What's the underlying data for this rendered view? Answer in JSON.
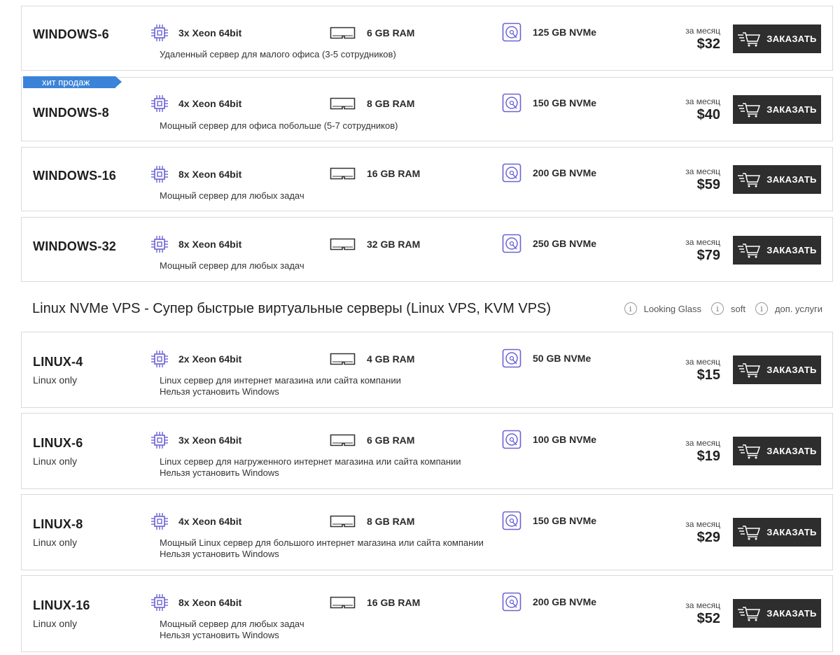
{
  "labels": {
    "per_month": "за месяц",
    "order": "ЗАКАЗАТЬ",
    "hit_badge": "хит продаж"
  },
  "icons": {
    "cpu": "cpu-icon",
    "ram": "ram-icon",
    "disk": "disk-icon",
    "cart": "cart-icon",
    "info": "info-icon"
  },
  "colors": {
    "accent": "#6b62d6",
    "button": "#2e2e2e",
    "badge": "#3b83d8"
  },
  "windows_plans": [
    {
      "name": "WINDOWS-6",
      "cpu": "3x Xeon 64bit",
      "ram": "6 GB RAM",
      "disk": "125 GB NVMe",
      "desc": "Удаленный сервер для малого офиса (3-5 сотрудников)",
      "price": "$32"
    },
    {
      "name": "WINDOWS-8",
      "cpu": "4x Xeon 64bit",
      "ram": "8 GB RAM",
      "disk": "150 GB NVMe",
      "desc": "Мощный сервер для офиса побольше (5-7 сотрудников)",
      "price": "$40"
    },
    {
      "name": "WINDOWS-16",
      "cpu": "8x Xeon 64bit",
      "ram": "16 GB RAM",
      "disk": "200 GB NVMe",
      "desc": "Мощный сервер для любых задач",
      "price": "$59"
    },
    {
      "name": "WINDOWS-32",
      "cpu": "8x Xeon 64bit",
      "ram": "32 GB RAM",
      "disk": "250 GB NVMe",
      "desc": "Мощный сервер для любых задач",
      "price": "$79"
    }
  ],
  "linux_section": {
    "title": "Linux NVMe VPS - Супер быстрые виртуальные серверы (Linux VPS, KVM VPS)",
    "links": [
      "Looking Glass",
      "soft",
      "доп. услуги"
    ]
  },
  "linux_plans": [
    {
      "name": "LINUX-4",
      "os": "Linux only",
      "cpu": "2x Xeon 64bit",
      "ram": "4 GB RAM",
      "disk": "50 GB NVMe",
      "desc": "Linux сервер для интернет магазина или сайта компании",
      "note": "Нельзя установить Windows",
      "price": "$15"
    },
    {
      "name": "LINUX-6",
      "os": "Linux only",
      "cpu": "3x Xeon 64bit",
      "ram": "6 GB RAM",
      "disk": "100 GB NVMe",
      "desc": "Linux сервер для нагруженного интернет магазина или сайта компании",
      "note": "Нельзя установить Windows",
      "price": "$19"
    },
    {
      "name": "LINUX-8",
      "os": "Linux only",
      "cpu": "4x Xeon 64bit",
      "ram": "8 GB RAM",
      "disk": "150 GB NVMe",
      "desc": "Мощный Linux сервер для большого интернет магазина или сайта компании",
      "note": "Нельзя установить Windows",
      "price": "$29"
    },
    {
      "name": "LINUX-16",
      "os": "Linux only",
      "cpu": "8x Xeon 64bit",
      "ram": "16 GB RAM",
      "disk": "200 GB NVMe",
      "desc": "Мощный сервер для любых задач",
      "note": "Нельзя установить Windows",
      "price": "$52"
    }
  ]
}
